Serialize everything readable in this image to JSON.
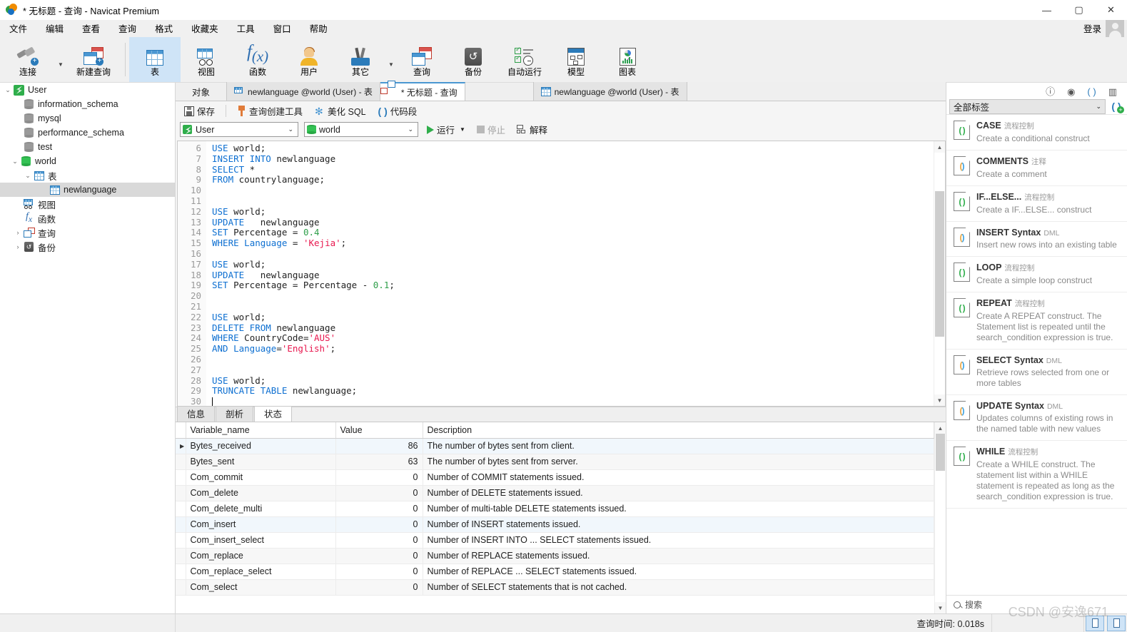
{
  "window": {
    "title": "* 无标题 - 查询 - Navicat Premium",
    "minimize": "—",
    "maximize": "▢",
    "close": "✕"
  },
  "menubar": {
    "items": [
      "文件",
      "编辑",
      "查看",
      "查询",
      "格式",
      "收藏夹",
      "工具",
      "窗口",
      "帮助"
    ],
    "login_label": "登录"
  },
  "toolbar": {
    "items": [
      {
        "label": "连接",
        "icon": "connection-icon",
        "has_dropdown": true
      },
      {
        "label": "新建查询",
        "icon": "new-query-icon",
        "has_dropdown": false
      },
      {
        "label": "表",
        "icon": "table-icon",
        "active": true
      },
      {
        "label": "视图",
        "icon": "view-icon"
      },
      {
        "label": "函数",
        "icon": "function-icon"
      },
      {
        "label": "用户",
        "icon": "user-icon"
      },
      {
        "label": "其它",
        "icon": "other-icon",
        "has_dropdown": true
      },
      {
        "label": "查询",
        "icon": "query-icon"
      },
      {
        "label": "备份",
        "icon": "backup-icon"
      },
      {
        "label": "自动运行",
        "icon": "automation-icon"
      },
      {
        "label": "模型",
        "icon": "model-icon"
      },
      {
        "label": "图表",
        "icon": "chart-icon"
      }
    ]
  },
  "sidebar": {
    "items": [
      {
        "label": "User",
        "icon": "connection-icon",
        "depth": 0,
        "twisty": "expanded"
      },
      {
        "label": "information_schema",
        "icon": "database-icon",
        "depth": 1,
        "twisty": ""
      },
      {
        "label": "mysql",
        "icon": "database-icon",
        "depth": 1,
        "twisty": ""
      },
      {
        "label": "performance_schema",
        "icon": "database-icon",
        "depth": 1,
        "twisty": ""
      },
      {
        "label": "test",
        "icon": "database-icon",
        "depth": 1,
        "twisty": ""
      },
      {
        "label": "world",
        "icon": "database-open-icon",
        "depth": 1,
        "twisty": "expanded"
      },
      {
        "label": "表",
        "icon": "table-icon",
        "depth": 2,
        "twisty": "expanded"
      },
      {
        "label": "newlanguage",
        "icon": "table-icon",
        "depth": 3,
        "twisty": "",
        "selected": true
      },
      {
        "label": "视图",
        "icon": "view-icon",
        "depth": 2,
        "twisty": ""
      },
      {
        "label": "函数",
        "icon": "function-icon",
        "depth": 2,
        "twisty": ""
      },
      {
        "label": "查询",
        "icon": "query-icon",
        "depth": 2,
        "twisty": "collapsed"
      },
      {
        "label": "备份",
        "icon": "backup-icon",
        "depth": 2,
        "twisty": "collapsed"
      }
    ]
  },
  "tabs": {
    "objects_button": "对象",
    "items": [
      {
        "label": "newlanguage @world (User) - 表",
        "icon": "table-design-icon",
        "active": false
      },
      {
        "label": "* 无标题 - 查询",
        "icon": "query-icon",
        "active": true
      },
      {
        "label": "newlanguage @world (User) - 表",
        "icon": "table-icon",
        "active": false,
        "detached": true
      }
    ]
  },
  "query_toolbar": {
    "save": "保存",
    "query_builder": "查询创建工具",
    "beautify_sql": "美化 SQL",
    "code_snippet": "代码段"
  },
  "query_bar": {
    "connection": "User",
    "database": "world",
    "run": "运行",
    "stop": "停止",
    "explain": "解释"
  },
  "editor": {
    "first_line_number": 6,
    "lines": [
      {
        "n": 6,
        "tokens": [
          {
            "t": "USE",
            "c": "kw"
          },
          {
            "t": " world;",
            "c": ""
          }
        ]
      },
      {
        "n": 7,
        "tokens": [
          {
            "t": "INSERT INTO",
            "c": "kw"
          },
          {
            "t": " newlanguage",
            "c": ""
          }
        ]
      },
      {
        "n": 8,
        "tokens": [
          {
            "t": "SELECT",
            "c": "kw"
          },
          {
            "t": " *",
            "c": ""
          }
        ]
      },
      {
        "n": 9,
        "tokens": [
          {
            "t": "FROM",
            "c": "kw"
          },
          {
            "t": " countrylanguage;",
            "c": ""
          }
        ]
      },
      {
        "n": 10,
        "tokens": []
      },
      {
        "n": 11,
        "tokens": []
      },
      {
        "n": 12,
        "tokens": [
          {
            "t": "USE",
            "c": "kw"
          },
          {
            "t": " world;",
            "c": ""
          }
        ]
      },
      {
        "n": 13,
        "tokens": [
          {
            "t": "UPDATE",
            "c": "kw"
          },
          {
            "t": "   newlanguage",
            "c": ""
          }
        ]
      },
      {
        "n": 14,
        "tokens": [
          {
            "t": "SET",
            "c": "kw"
          },
          {
            "t": " Percentage = ",
            "c": ""
          },
          {
            "t": "0.4",
            "c": "num"
          }
        ]
      },
      {
        "n": 15,
        "tokens": [
          {
            "t": "WHERE",
            "c": "kw"
          },
          {
            "t": " ",
            "c": ""
          },
          {
            "t": "Language",
            "c": "kw"
          },
          {
            "t": " = ",
            "c": ""
          },
          {
            "t": "'Kejia'",
            "c": "str"
          },
          {
            "t": ";",
            "c": ""
          }
        ]
      },
      {
        "n": 16,
        "tokens": []
      },
      {
        "n": 17,
        "tokens": [
          {
            "t": "USE",
            "c": "kw"
          },
          {
            "t": " world;",
            "c": ""
          }
        ]
      },
      {
        "n": 18,
        "tokens": [
          {
            "t": "UPDATE",
            "c": "kw"
          },
          {
            "t": "   newlanguage",
            "c": ""
          }
        ]
      },
      {
        "n": 19,
        "tokens": [
          {
            "t": "SET",
            "c": "kw"
          },
          {
            "t": " Percentage = Percentage - ",
            "c": ""
          },
          {
            "t": "0.1",
            "c": "num"
          },
          {
            "t": ";",
            "c": ""
          }
        ]
      },
      {
        "n": 20,
        "tokens": []
      },
      {
        "n": 21,
        "tokens": []
      },
      {
        "n": 22,
        "tokens": [
          {
            "t": "USE",
            "c": "kw"
          },
          {
            "t": " world;",
            "c": ""
          }
        ]
      },
      {
        "n": 23,
        "tokens": [
          {
            "t": "DELETE FROM",
            "c": "kw"
          },
          {
            "t": " newlanguage",
            "c": ""
          }
        ]
      },
      {
        "n": 24,
        "tokens": [
          {
            "t": "WHERE",
            "c": "kw"
          },
          {
            "t": " CountryCode=",
            "c": ""
          },
          {
            "t": "'AUS'",
            "c": "str"
          }
        ]
      },
      {
        "n": 25,
        "tokens": [
          {
            "t": "AND",
            "c": "kw"
          },
          {
            "t": " ",
            "c": ""
          },
          {
            "t": "Language",
            "c": "kw"
          },
          {
            "t": "=",
            "c": ""
          },
          {
            "t": "'English'",
            "c": "str"
          },
          {
            "t": ";",
            "c": ""
          }
        ]
      },
      {
        "n": 26,
        "tokens": []
      },
      {
        "n": 27,
        "tokens": []
      },
      {
        "n": 28,
        "tokens": [
          {
            "t": "USE",
            "c": "kw"
          },
          {
            "t": " world;",
            "c": ""
          }
        ]
      },
      {
        "n": 29,
        "tokens": [
          {
            "t": "TRUNCATE TABLE",
            "c": "kw"
          },
          {
            "t": " newlanguage;",
            "c": ""
          }
        ]
      },
      {
        "n": 30,
        "tokens": [],
        "caret": true
      }
    ]
  },
  "results": {
    "tabs": [
      {
        "label": "信息",
        "active": false
      },
      {
        "label": "剖析",
        "active": false
      },
      {
        "label": "状态",
        "active": true
      }
    ],
    "columns": [
      "Variable_name",
      "Value",
      "Description"
    ],
    "rows": [
      {
        "name": "Bytes_received",
        "value": "86",
        "desc": "The number of bytes sent from client.",
        "marked": true
      },
      {
        "name": "Bytes_sent",
        "value": "63",
        "desc": "The number of bytes sent from server."
      },
      {
        "name": "Com_commit",
        "value": "0",
        "desc": "Number of COMMIT statements issued."
      },
      {
        "name": "Com_delete",
        "value": "0",
        "desc": "Number of DELETE statements issued."
      },
      {
        "name": "Com_delete_multi",
        "value": "0",
        "desc": "Number of multi-table DELETE statements issued."
      },
      {
        "name": "Com_insert",
        "value": "0",
        "desc": "Number of INSERT statements issued."
      },
      {
        "name": "Com_insert_select",
        "value": "0",
        "desc": "Number of INSERT INTO ... SELECT statements issued."
      },
      {
        "name": "Com_replace",
        "value": "0",
        "desc": "Number of REPLACE statements issued."
      },
      {
        "name": "Com_replace_select",
        "value": "0",
        "desc": "Number of REPLACE ... SELECT statements issued."
      },
      {
        "name": "Com_select",
        "value": "0",
        "desc": "Number of SELECT statements that is not cached."
      }
    ]
  },
  "statusbar": {
    "query_time": "查询时间: 0.018s"
  },
  "right_panel": {
    "header_icons": [
      "info-icon",
      "eye-icon",
      "snippet-icon",
      "structure-icon"
    ],
    "filter_value": "全部标签",
    "search_placeholder": "搜索",
    "snippets": [
      {
        "title": "CASE",
        "tag": "流程控制",
        "desc": "Create a conditional construct",
        "color": "green"
      },
      {
        "title": "COMMENTS",
        "tag": "注释",
        "desc": "Create a comment",
        "color": "duo"
      },
      {
        "title": "IF...ELSE...",
        "tag": "流程控制",
        "desc": "Create a IF...ELSE... construct",
        "color": "green"
      },
      {
        "title": "INSERT Syntax",
        "tag": "DML",
        "desc": "Insert new rows into an existing table",
        "color": "duo"
      },
      {
        "title": "LOOP",
        "tag": "流程控制",
        "desc": "Create a simple loop construct",
        "color": "green"
      },
      {
        "title": "REPEAT",
        "tag": "流程控制",
        "desc": "Create A REPEAT construct. The Statement list is repeated until the search_condition expression is true.",
        "color": "green"
      },
      {
        "title": "SELECT Syntax",
        "tag": "DML",
        "desc": "Retrieve rows selected from one or more tables",
        "color": "duo"
      },
      {
        "title": "UPDATE Syntax",
        "tag": "DML",
        "desc": "Updates columns of existing rows in the named table with new values",
        "color": "duo"
      },
      {
        "title": "WHILE",
        "tag": "流程控制",
        "desc": "Create a WHILE construct. The statement list within a WHILE statement is repeated as long as the search_condition expression is true.",
        "color": "green"
      }
    ]
  },
  "watermark": "CSDN @安逸671"
}
